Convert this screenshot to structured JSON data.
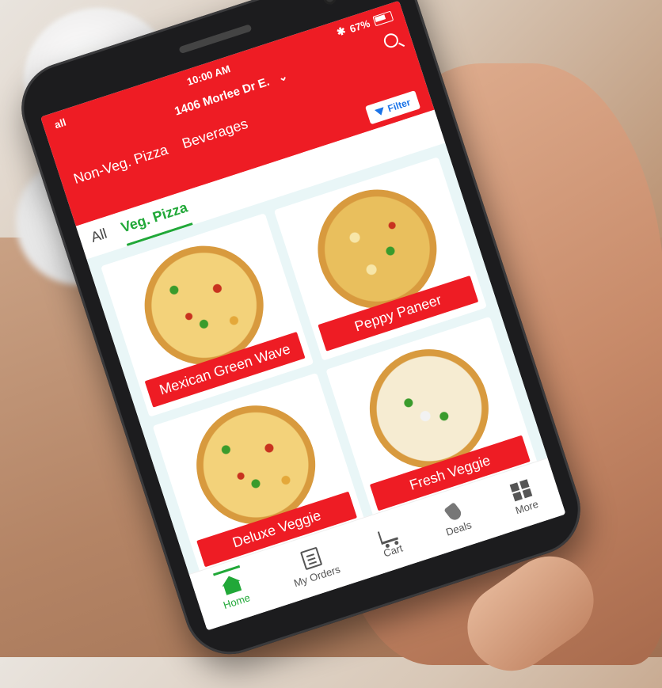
{
  "status": {
    "signal": "all",
    "time": "10:00 AM",
    "battery": "67%"
  },
  "header": {
    "location": "1406 Morlee Dr E.",
    "top_tabs": [
      "Non-Veg. Pizza",
      "Beverages"
    ],
    "filter_label": "Filter"
  },
  "categories": {
    "tabs": [
      "All",
      "Veg. Pizza"
    ],
    "active": "Veg. Pizza"
  },
  "menu": {
    "items": [
      {
        "name": "Mexican Green Wave"
      },
      {
        "name": "Peppy Paneer"
      },
      {
        "name": "Deluxe Veggie"
      },
      {
        "name": "Fresh Veggie"
      },
      {
        "name": ""
      },
      {
        "name": ""
      }
    ]
  },
  "bottom_nav": {
    "items": [
      {
        "label": "Home",
        "icon": "home-icon"
      },
      {
        "label": "My Orders",
        "icon": "orders-icon"
      },
      {
        "label": "Cart",
        "icon": "cart-icon"
      },
      {
        "label": "Deals",
        "icon": "deals-icon"
      },
      {
        "label": "More",
        "icon": "more-icon"
      }
    ]
  },
  "colors": {
    "brand_red": "#ee1c24",
    "accent_green": "#21a838",
    "grid_bg": "#e9f6f7",
    "filter_blue": "#1a73e8"
  }
}
